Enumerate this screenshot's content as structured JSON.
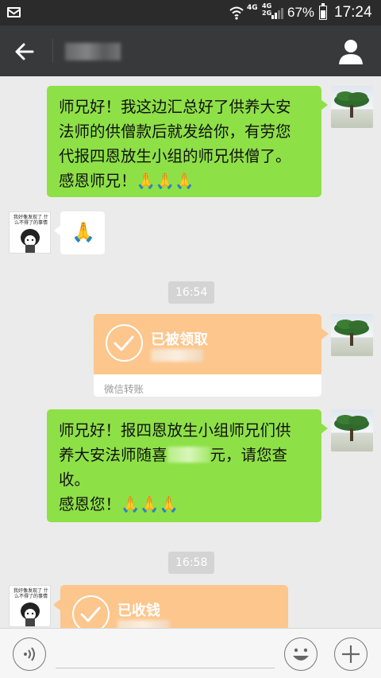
{
  "status_bar": {
    "network_1": "4G",
    "network_2_top": "4G",
    "network_2_bottom": "2G",
    "battery": "67%",
    "time": "17:24"
  },
  "header": {
    "back_icon": "arrow-left-icon",
    "profile_icon": "person-icon"
  },
  "messages": [
    {
      "type": "text",
      "side": "right",
      "lines": [
        "师兄好！我这边汇总好了供养大安",
        "法师的供僧款后就发给你，有劳您",
        "代报四恩放生小组的师兄供僧了。",
        "感恩师兄！🙏🙏🙏"
      ]
    },
    {
      "type": "emoji",
      "side": "left",
      "avatar_caption": "我好像发现了 什么不得了的事情",
      "content": "🙏"
    },
    {
      "type": "time",
      "text": "16:54"
    },
    {
      "type": "transfer",
      "side": "right",
      "title": "已被领取",
      "footer": "微信转账"
    },
    {
      "type": "text",
      "side": "right",
      "lines_1": "师兄好！报四恩放生小组师兄们供",
      "line_2_before": "养大安法师随喜",
      "line_2_after": "元，请您查",
      "lines_3": "收。",
      "lines_4": "感恩您！🙏🙏🙏"
    },
    {
      "type": "time",
      "text": "16:58"
    },
    {
      "type": "transfer",
      "side": "left",
      "avatar_caption": "我好像发现了 什么不得了的事情",
      "title": "已收钱"
    }
  ],
  "input_bar": {
    "voice_icon": "voice-icon",
    "emoji_icon": "smiley-icon",
    "plus_icon": "plus-icon"
  },
  "colors": {
    "status_bg": "#2b2b2b",
    "titlebar_bg": "#37393b",
    "chat_bg": "#ebebeb",
    "green_bubble": "#8ee047",
    "transfer_orange": "#fcc68d"
  }
}
